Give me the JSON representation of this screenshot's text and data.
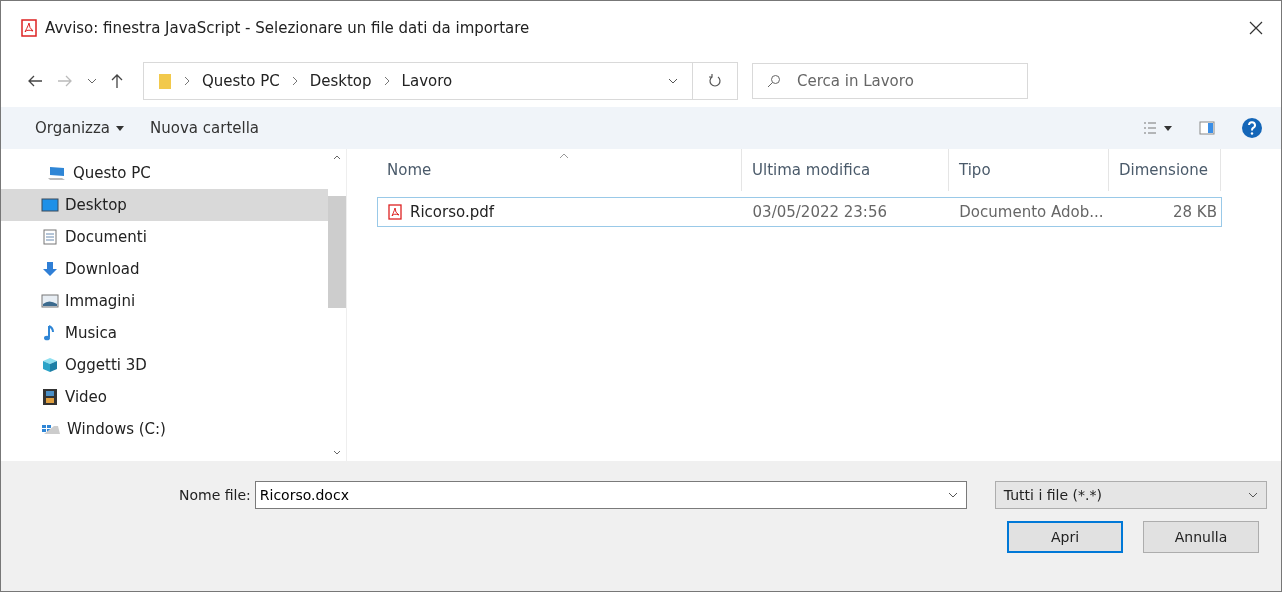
{
  "window": {
    "title": "Avviso: finestra JavaScript - Selezionare un file dati da importare"
  },
  "address": {
    "breadcrumb": [
      "Questo PC",
      "Desktop",
      "Lavoro"
    ]
  },
  "search": {
    "placeholder": "Cerca in Lavoro"
  },
  "toolbar": {
    "items": [
      "Organizza",
      "Nuova cartella"
    ]
  },
  "sidebar": {
    "items": [
      {
        "label": "Questo PC",
        "kind": "pc",
        "selected": false,
        "children": [
          {
            "label": "Desktop",
            "kind": "desktop",
            "selected": true
          },
          {
            "label": "Documenti",
            "kind": "documents",
            "selected": false
          },
          {
            "label": "Download",
            "kind": "download",
            "selected": false
          },
          {
            "label": "Immagini",
            "kind": "images",
            "selected": false
          },
          {
            "label": "Musica",
            "kind": "music",
            "selected": false
          },
          {
            "label": "Oggetti 3D",
            "kind": "objects",
            "selected": false
          },
          {
            "label": "Video",
            "kind": "video",
            "selected": false
          },
          {
            "label": "Windows (C:)",
            "kind": "drive",
            "selected": false
          }
        ]
      }
    ]
  },
  "table": {
    "columns": [
      {
        "label": "Nome",
        "sorted": true
      },
      {
        "label": "Ultima modifica",
        "sorted": false
      },
      {
        "label": "Tipo",
        "sorted": false
      },
      {
        "label": "Dimensione",
        "sorted": false
      }
    ],
    "rows": [
      {
        "name": "Ricorso.pdf",
        "modified": "03/05/2022 23:56",
        "type": "Documento Adob...",
        "size": "28 KB",
        "selected": true
      }
    ]
  },
  "footer": {
    "filename_label": "Nome file:",
    "filename": "Ricorso.docx",
    "filter": "Tutti i file (*.*)",
    "buttons": [
      {
        "label": "Apri",
        "default": true
      },
      {
        "label": "Annulla",
        "default": false
      }
    ]
  }
}
